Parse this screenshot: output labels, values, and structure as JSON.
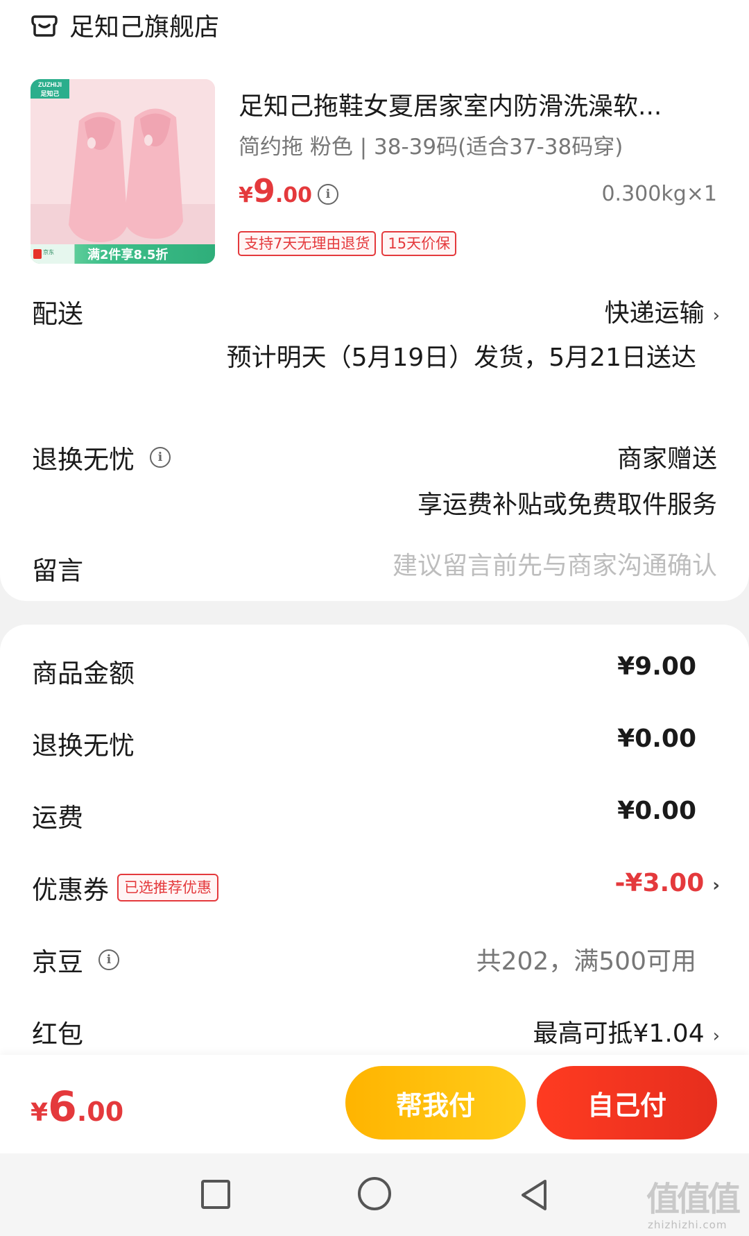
{
  "shop": {
    "name": "足知己旗舰店",
    "icon": "store-icon"
  },
  "product": {
    "image_brand": "ZUZHIJI\n足知己",
    "image_promo_badge": "京东\n物流",
    "image_promo": "满2件享8.5折",
    "title": "足知己拖鞋女夏居家室内防滑洗澡软...",
    "spec": "简约拖 粉色 | 38-39码(适合37-38码穿)",
    "price_symbol": "¥",
    "price_int": "9",
    "price_dec": ".00",
    "weight": "0.300kg×1",
    "tags": [
      "支持7天无理由退货",
      "15天价保"
    ]
  },
  "delivery": {
    "label": "配送",
    "value": "快递运输",
    "sub": "预计明天（5月19日）发货，5月21日送达"
  },
  "returns": {
    "label": "退换无忧",
    "value": "商家赠送",
    "sub": "享运费补贴或免费取件服务"
  },
  "message": {
    "label": "留言",
    "placeholder": "建议留言前先与商家沟通确认",
    "value": ""
  },
  "summary": {
    "goods_label": "商品金额",
    "goods_value": "¥9.00",
    "returns_label": "退换无忧",
    "returns_value": "¥0.00",
    "shipping_label": "运费",
    "shipping_value": "¥0.00",
    "coupon_label": "优惠券",
    "coupon_tag": "已选推荐优惠",
    "coupon_value": "-¥3.00",
    "bean_label": "京豆",
    "bean_value": "共202，满500可用",
    "redpacket_label": "红包",
    "redpacket_value": "最高可抵¥1.04"
  },
  "bottom": {
    "total_symbol": "¥",
    "total_int": "6",
    "total_dec": ".00",
    "friend_pay_label": "帮我付",
    "self_pay_label": "自己付"
  },
  "watermark": {
    "glyphs": "值值值",
    "text": "zhizhizhi.com"
  },
  "colors": {
    "accent_red": "#e4393c",
    "button_yellow": "#ffc107",
    "button_red": "#f23a20"
  }
}
